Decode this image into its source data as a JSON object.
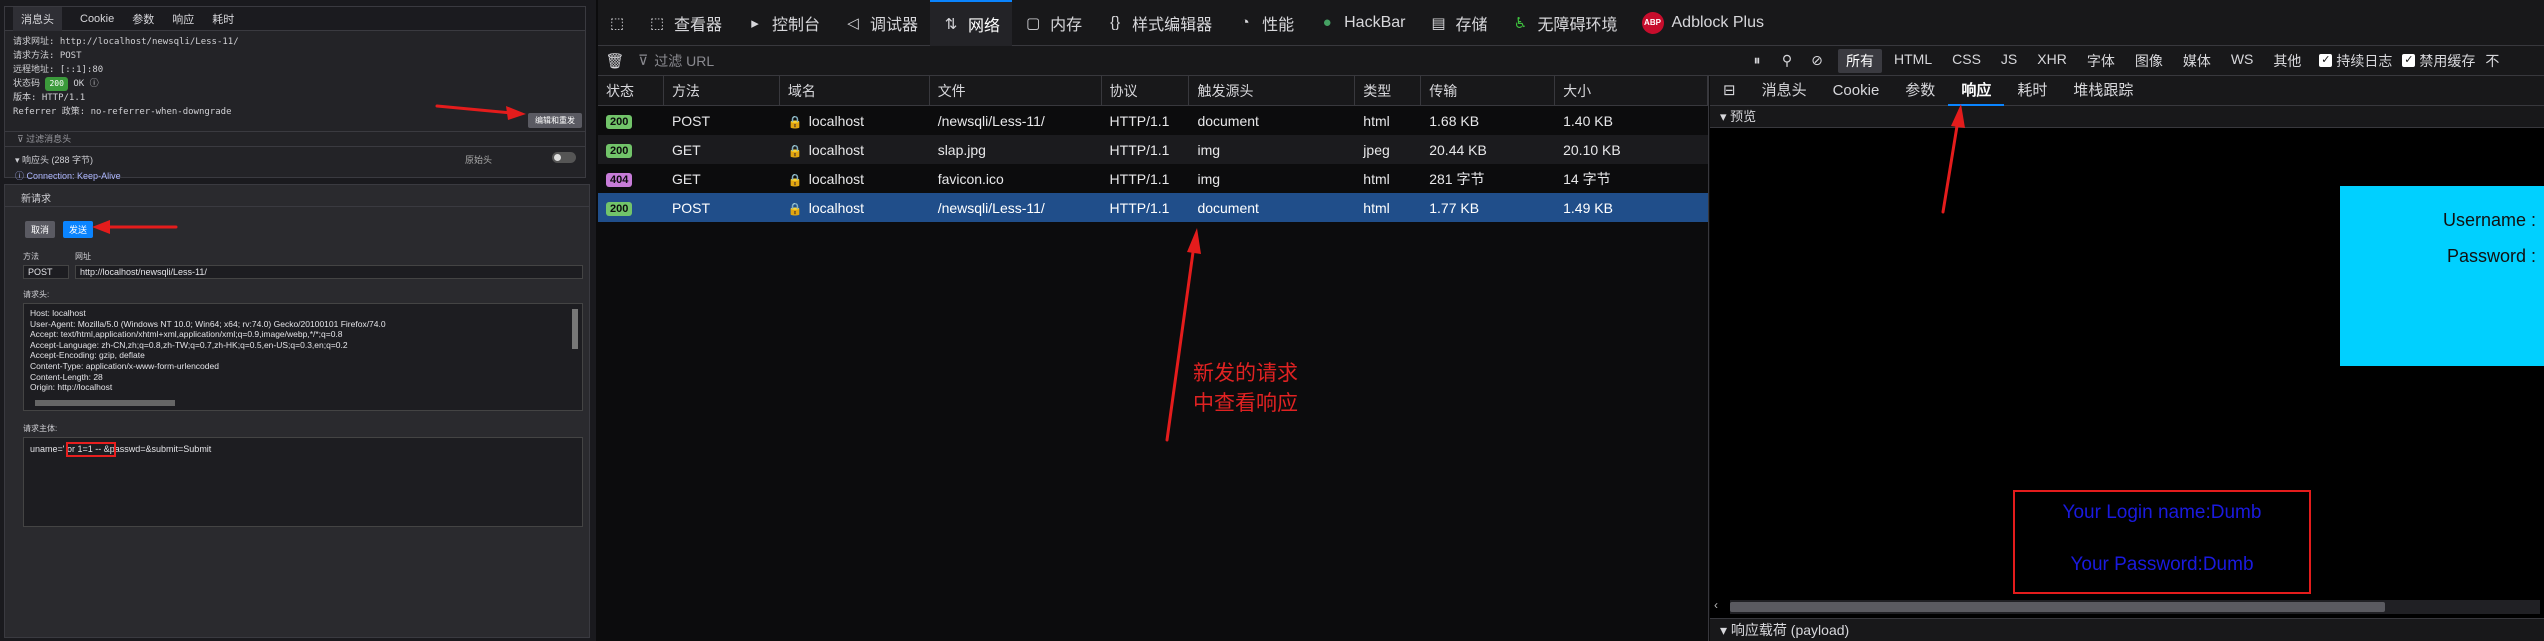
{
  "left_panel": {
    "tabs": [
      "消息头",
      "Cookie",
      "参数",
      "响应",
      "耗时"
    ],
    "summary_lines": [
      "请求网址: http://localhost/newsqli/Less-11/",
      "请求方法: POST",
      "远程地址: [::1]:80"
    ],
    "status_label": "状态码",
    "status_code": "200",
    "status_text": "OK",
    "version_line": "版本: HTTP/1.1",
    "referrer_line": "Referrer 政策: no-referrer-when-downgrade",
    "resend_button": "编辑和重发",
    "filter_placeholder": "过滤消息头",
    "response_headers": "响应头 (288 字节)",
    "raw_label": "原始头",
    "connection_line": "Connection: Keep-Alive",
    "new_request_title": "新请求",
    "cancel_button": "取消",
    "send_button": "发送",
    "method_label": "方法",
    "url_label": "网址",
    "method_value": "POST",
    "url_value": "http://localhost/newsqli/Less-11/",
    "headers_label": "请求头:",
    "header_lines": [
      "Host: localhost",
      "User-Agent: Mozilla/5.0 (Windows NT 10.0; Win64; x64; rv:74.0) Gecko/20100101 Firefox/74.0",
      "Accept: text/html,application/xhtml+xml,application/xml;q=0.9,image/webp,*/*;q=0.8",
      "Accept-Language: zh-CN,zh;q=0.8,zh-TW;q=0.7,zh-HK;q=0.5,en-US;q=0.3,en;q=0.2",
      "Accept-Encoding: gzip, deflate",
      "Content-Type: application/x-www-form-urlencoded",
      "Content-Length: 28",
      "Origin: http://localhost"
    ],
    "body_label": "请求主体:",
    "body_value": "uname=' or 1=1 -- &passwd=&submit=Submit"
  },
  "toolbar": {
    "tabs": [
      {
        "icon": "inspector-icon",
        "glyph": "⬚",
        "label": "查看器"
      },
      {
        "icon": "console-icon",
        "glyph": "▸",
        "label": "控制台"
      },
      {
        "icon": "debugger-icon",
        "glyph": "◁",
        "label": "调试器"
      },
      {
        "icon": "network-icon",
        "glyph": "⇅",
        "label": "网络"
      },
      {
        "icon": "memory-icon",
        "glyph": "▢",
        "label": "内存"
      },
      {
        "icon": "style-editor-icon",
        "glyph": "{}",
        "label": "样式编辑器"
      },
      {
        "icon": "performance-icon",
        "glyph": "◔",
        "label": "性能"
      },
      {
        "icon": "hackbar-icon",
        "glyph": "●",
        "label": "HackBar"
      },
      {
        "icon": "storage-icon",
        "glyph": "▤",
        "label": "存储"
      },
      {
        "icon": "accessibility-icon",
        "glyph": "♿",
        "label": "无障碍环境"
      },
      {
        "icon": "adblock-icon",
        "glyph": "ABP",
        "label": "Adblock Plus"
      }
    ],
    "active_tab": "网络"
  },
  "filterbar": {
    "placeholder": "过滤 URL",
    "types": [
      "所有",
      "HTML",
      "CSS",
      "JS",
      "XHR",
      "字体",
      "图像",
      "媒体",
      "WS",
      "其他"
    ],
    "active_type": "所有",
    "persist_log": "持续日志",
    "disable_cache": "禁用缓存",
    "throttle": "不"
  },
  "table": {
    "columns": [
      "状态",
      "方法",
      "域名",
      "文件",
      "协议",
      "触发源头",
      "类型",
      "传输",
      "大小"
    ],
    "rows": [
      {
        "status": "200",
        "method": "POST",
        "domain": "localhost",
        "file": "/newsqli/Less-11/",
        "protocol": "HTTP/1.1",
        "cause": "document",
        "type": "html",
        "transferred": "1.68 KB",
        "size": "1.40 KB"
      },
      {
        "status": "200",
        "method": "GET",
        "domain": "localhost",
        "file": "slap.jpg",
        "protocol": "HTTP/1.1",
        "cause": "img",
        "type": "jpeg",
        "transferred": "20.44 KB",
        "size": "20.10 KB"
      },
      {
        "status": "404",
        "method": "GET",
        "domain": "localhost",
        "file": "favicon.ico",
        "protocol": "HTTP/1.1",
        "cause": "img",
        "type": "html",
        "transferred": "281 字节",
        "size": "14 字节"
      },
      {
        "status": "200",
        "method": "POST",
        "domain": "localhost",
        "file": "/newsqli/Less-11/",
        "protocol": "HTTP/1.1",
        "cause": "document",
        "type": "html",
        "transferred": "1.77 KB",
        "size": "1.49 KB"
      }
    ],
    "selected_row": 3
  },
  "annotation": {
    "line1": "新发的请求",
    "line2": "中查看响应"
  },
  "response_panel": {
    "tabs": [
      "消息头",
      "Cookie",
      "参数",
      "响应",
      "耗时",
      "堆栈跟踪"
    ],
    "active_tab": "响应",
    "preview_label": "预览",
    "username_label": "Username :",
    "password_label": "Password :",
    "login_name": "Your Login name:Dumb",
    "login_password": "Your Password:Dumb",
    "payload_label": "响应载荷 (payload)"
  },
  "colors": {
    "accent": "#0a84ff",
    "annotation_red": "#e02222",
    "cyan_box": "#00d0ff",
    "selected_row": "#204e8a"
  }
}
